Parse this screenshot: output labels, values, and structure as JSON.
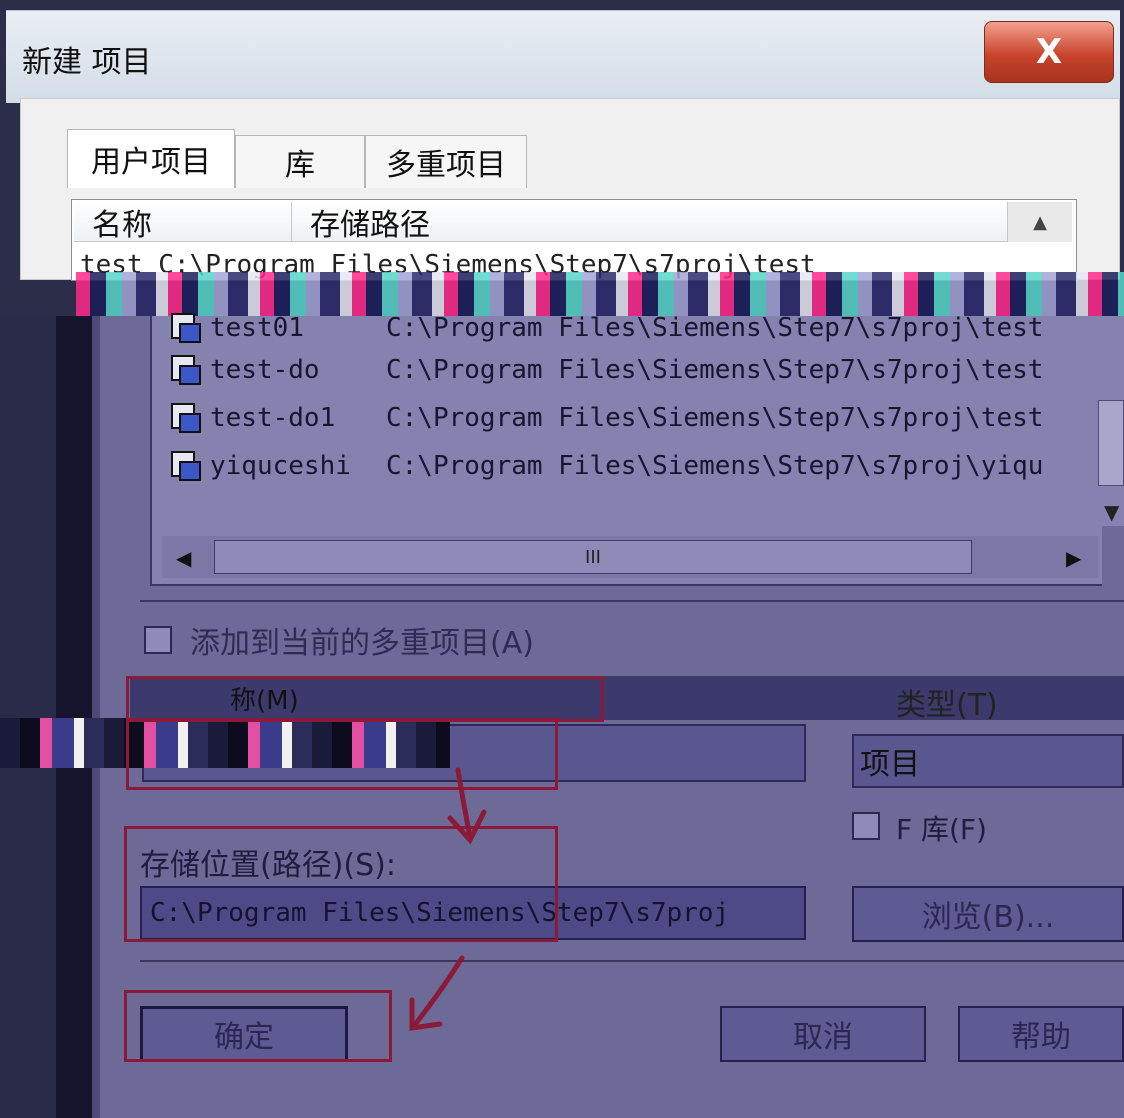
{
  "window": {
    "title": "新建 项目",
    "close_label": "X"
  },
  "tabs": [
    {
      "label": "用户项目",
      "active": true
    },
    {
      "label": "库",
      "active": false
    },
    {
      "label": "多重项目",
      "active": false
    }
  ],
  "project_list": {
    "columns": {
      "name": "名称",
      "path": "存储路径"
    },
    "peek_row": "test  C:\\Program Files\\Siemens\\Step7\\s7proj\\test",
    "rows": [
      {
        "name": "test01",
        "path": "C:\\Program Files\\Siemens\\Step7\\s7proj\\test"
      },
      {
        "name": "test-do",
        "path": "C:\\Program Files\\Siemens\\Step7\\s7proj\\test"
      },
      {
        "name": "test-do1",
        "path": "C:\\Program Files\\Siemens\\Step7\\s7proj\\test"
      },
      {
        "name": "yiquceshi",
        "path": "C:\\Program Files\\Siemens\\Step7\\s7proj\\yiqu"
      }
    ],
    "hscroll_grip": "III"
  },
  "options": {
    "add_to_multiproject": "添加到当前的多重项目(A)",
    "name_label": "称(M)",
    "type_label": "类型(T)",
    "type_value": "项目",
    "f_library": "F 库(F)",
    "storage_label": "存储位置(路径)(S):",
    "storage_path": "C:\\Program Files\\Siemens\\Step7\\s7proj"
  },
  "buttons": {
    "browse": "浏览(B)...",
    "ok": "确定",
    "cancel": "取消",
    "help": "帮助"
  },
  "colors": {
    "annotation": "#8b1a38",
    "dialog_tint": "#6d6a98"
  }
}
